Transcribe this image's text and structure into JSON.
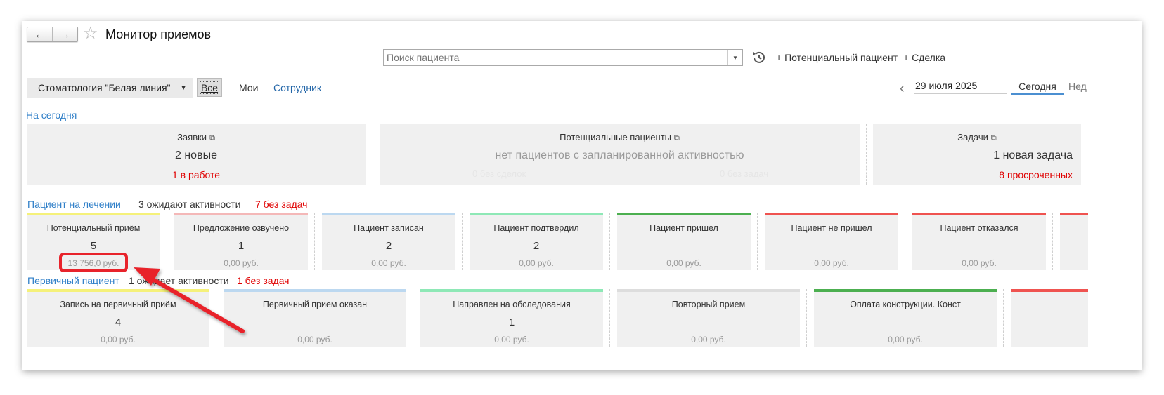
{
  "window": {
    "title": "Монитор приемов"
  },
  "toolbar": {
    "search_placeholder": "Поиск пациента",
    "add_potential": "+ Потенциальный пациент",
    "add_deal": "+ Сделка"
  },
  "filters": {
    "organization": "Стоматология \"Белая линия\"",
    "tab_all": "Все",
    "tab_mine": "Мои",
    "tab_employee": "Сотрудник"
  },
  "date": {
    "value": "29 июля 2025",
    "today": "Сегодня",
    "next_cut": "Нед"
  },
  "today_section": {
    "title": "На сегодня",
    "cards": [
      {
        "title": "Заявки",
        "value": "2 новые",
        "sub": "1 в работе"
      },
      {
        "title": "Потенциальные пациенты",
        "value": "нет пациентов с запланированной активностью",
        "ghost1": "0 без сделок",
        "ghost2": "0 без задач"
      },
      {
        "title": "Задачи",
        "value": "1 новая задача",
        "sub": "8 просроченных"
      }
    ]
  },
  "treatment": {
    "title": "Пациент на лечении",
    "await": "3 ожидают активности",
    "no_tasks": "7 без задач",
    "tiles": [
      {
        "title": "Потенциальный приём",
        "count": "5",
        "sum": "13 756,0 руб.",
        "color": "#f5f17a"
      },
      {
        "title": "Предложение озвучено",
        "count": "1",
        "sum": "0,00 руб.",
        "color": "#f4b8b8"
      },
      {
        "title": "Пациент записан",
        "count": "2",
        "sum": "0,00 руб.",
        "color": "#bcd8f0"
      },
      {
        "title": "Пациент подтвердил",
        "count": "2",
        "sum": "0,00 руб.",
        "color": "#8ee8b6"
      },
      {
        "title": "Пациент пришел",
        "count": "",
        "sum": "0,00 руб.",
        "color": "#4caf50"
      },
      {
        "title": "Пациент не пришел",
        "count": "",
        "sum": "0,00 руб.",
        "color": "#ef5350"
      },
      {
        "title": "Пациент отказался",
        "count": "",
        "sum": "0,00 руб.",
        "color": "#ef5350"
      }
    ]
  },
  "primary": {
    "title": "Первичный пациент",
    "await": "1 ожидает активности",
    "no_tasks": "1 без задач",
    "tiles": [
      {
        "title": "Запись на первичный приём",
        "count": "4",
        "sum": "0,00 руб.",
        "color": "#f5f17a"
      },
      {
        "title": "Первичный прием оказан",
        "count": "",
        "sum": "0,00 руб.",
        "color": "#bcd8f0"
      },
      {
        "title": "Направлен на обследования",
        "count": "1",
        "sum": "0,00 руб.",
        "color": "#8ee8b6"
      },
      {
        "title": "Повторный прием",
        "count": "",
        "sum": "0,00 руб.",
        "color": "#dddddd"
      },
      {
        "title": "Оплата конструкции. Конст",
        "count": "",
        "sum": "0,00 руб.",
        "color": "#4caf50"
      }
    ]
  },
  "colors": {
    "link": "#2f7fc8",
    "alert": "#e00000",
    "annotation": "#e8232b"
  }
}
